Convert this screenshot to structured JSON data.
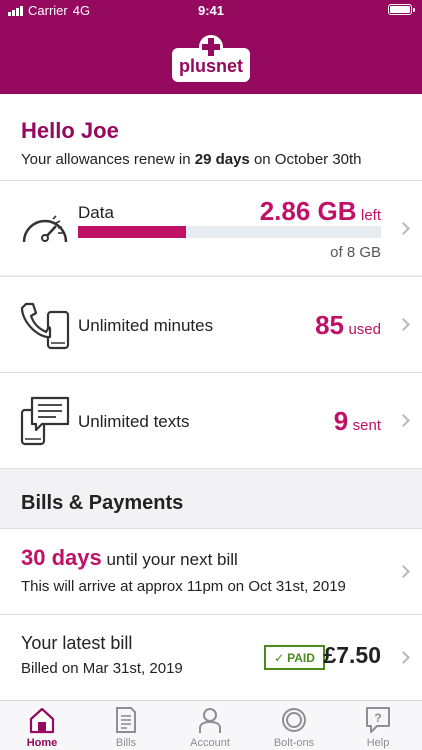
{
  "status_bar": {
    "carrier": "Carrier",
    "network": "4G",
    "time": "9:41"
  },
  "brand": {
    "logo_text": "plusnet",
    "color": "#95095f",
    "accent": "#c01167"
  },
  "greeting": {
    "title": "Hello Joe",
    "renew_prefix": "Your allowances renew in",
    "renew_days": "29 days",
    "renew_suffix": "on October 30th"
  },
  "allowances": {
    "data": {
      "label": "Data",
      "value": "2.86 GB",
      "unit": "left",
      "total": "of 8 GB",
      "used_fraction": 0.357,
      "icon": "speedometer-icon"
    },
    "minutes": {
      "label": "Unlimited minutes",
      "value": "85",
      "unit": "used",
      "icon": "phone-icon"
    },
    "texts": {
      "label": "Unlimited texts",
      "value": "9",
      "unit": "sent",
      "icon": "message-icon"
    }
  },
  "bills": {
    "section_title": "Bills & Payments",
    "next": {
      "days": "30 days",
      "text": "until your next bill",
      "arrive": "This will arrive at approx 11pm on Oct 31st, 2019"
    },
    "latest": {
      "title": "Your latest bill",
      "date": "Billed on Mar 31st, 2019",
      "badge": "PAID",
      "amount": "£7.50"
    }
  },
  "tabs": [
    {
      "label": "Home",
      "icon": "home-icon",
      "active": true
    },
    {
      "label": "Bills",
      "icon": "bills-icon",
      "active": false
    },
    {
      "label": "Account",
      "icon": "account-icon",
      "active": false
    },
    {
      "label": "Bolt-ons",
      "icon": "bolt-ons-icon",
      "active": false
    },
    {
      "label": "Help",
      "icon": "help-icon",
      "active": false
    }
  ]
}
